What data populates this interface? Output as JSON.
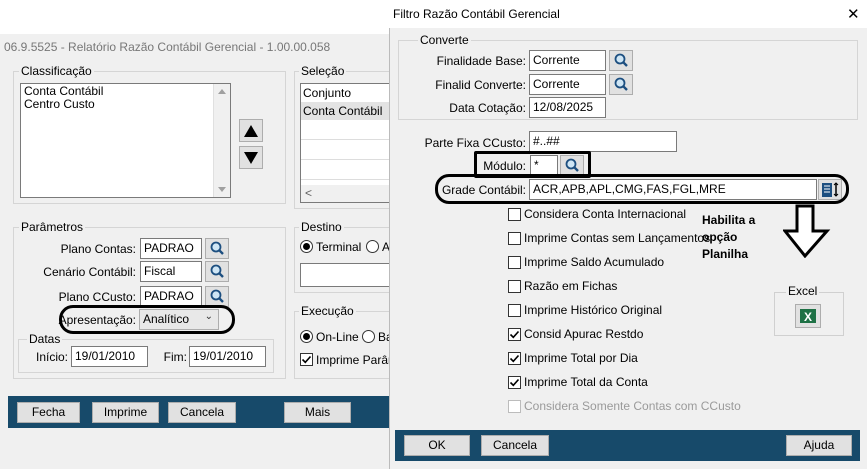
{
  "left_window": {
    "title": "06.9.5525 - Relatório Razão Contábil Gerencial - 1.00.00.058",
    "classificacao": {
      "label": "Classificação",
      "items": [
        "Conta Contábil",
        "Centro Custo"
      ]
    },
    "selecao": {
      "label": "Seleção",
      "items": [
        "Conjunto",
        "Conta Contábil",
        "",
        "",
        "",
        ""
      ]
    },
    "parametros": {
      "label": "Parâmetros",
      "plano_contas": {
        "label": "Plano Contas:",
        "value": "PADRAO"
      },
      "cenario": {
        "label": "Cenário Contábil:",
        "value": "Fiscal"
      },
      "plano_ccusto": {
        "label": "Plano CCusto:",
        "value": "PADRAO"
      },
      "apresentacao": {
        "label": "Apresentação:",
        "value": "Analítico"
      }
    },
    "datas": {
      "label": "Datas",
      "inicio_label": "Início:",
      "inicio_value": "19/01/2010",
      "fim_label": "Fim:",
      "fim_value": "19/01/2010"
    },
    "destino": {
      "label": "Destino",
      "terminal": "Terminal",
      "other": "A"
    },
    "execucao": {
      "label": "Execução",
      "online": "On-Line",
      "other": "Ba",
      "imprime": "Imprime Parâme"
    },
    "buttons": {
      "fecha": "Fecha",
      "imprime": "Imprime",
      "cancela": "Cancela",
      "mais": "Mais"
    }
  },
  "dialog": {
    "title": "Filtro Razão Contábil Gerencial",
    "close": "✕",
    "converte": {
      "label": "Converte",
      "finalidade_base": {
        "label": "Finalidade Base:",
        "value": "Corrente"
      },
      "finalid_converte": {
        "label": "Finalid Converte:",
        "value": "Corrente"
      },
      "data_cotacao": {
        "label": "Data Cotação:",
        "value": "12/08/2025"
      }
    },
    "parte_fixa": {
      "label": "Parte Fixa CCusto:",
      "value": "#..##"
    },
    "modulo": {
      "label": "Módulo:",
      "value": "*"
    },
    "grade": {
      "label": "Grade Contábil:",
      "value": "ACR,APB,APL,CMG,FAS,FGL,MRE"
    },
    "annotation": "Habilita a opção Planilha",
    "excel_label": "Excel",
    "checks": [
      {
        "label": "Considera Conta Internacional",
        "checked": false,
        "enabled": true
      },
      {
        "label": "Imprime Contas sem Lançamentos",
        "checked": false,
        "enabled": true
      },
      {
        "label": "Imprime Saldo Acumulado",
        "checked": false,
        "enabled": true
      },
      {
        "label": "Razão em Fichas",
        "checked": false,
        "enabled": true
      },
      {
        "label": "Imprime Histórico Original",
        "checked": false,
        "enabled": true
      },
      {
        "label": "Consid Apurac Restdo",
        "checked": true,
        "enabled": true
      },
      {
        "label": "Imprime Total por Dia",
        "checked": true,
        "enabled": true
      },
      {
        "label": "Imprime Total da Conta",
        "checked": true,
        "enabled": true
      },
      {
        "label": "Considera Somente Contas com CCusto",
        "checked": false,
        "enabled": false
      }
    ],
    "buttons": {
      "ok": "OK",
      "cancela": "Cancela",
      "ajuda": "Ajuda"
    }
  },
  "colors": {
    "footer_bar": "#174a6a",
    "annotation_border": "#000000",
    "window_bg": "#f0f0f0"
  }
}
